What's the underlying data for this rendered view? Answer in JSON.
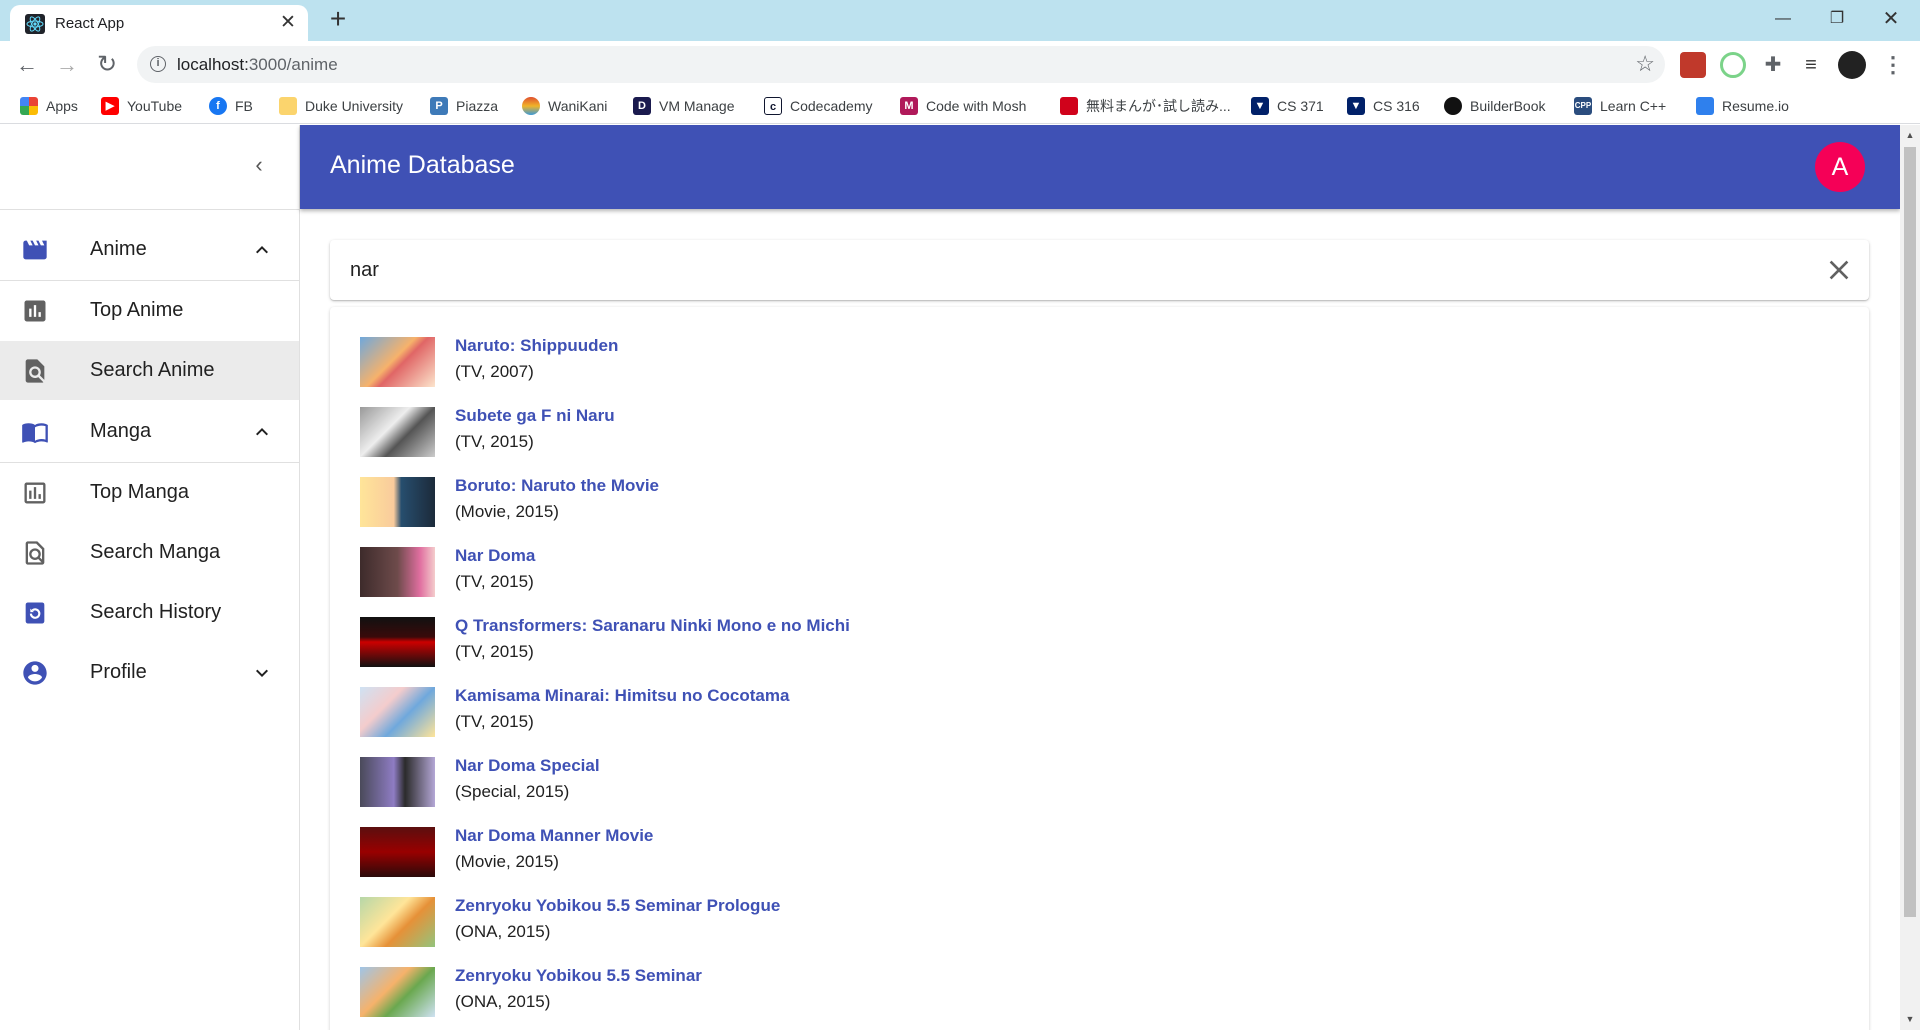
{
  "browser": {
    "tab_title": "React App",
    "url_host": "localhost:",
    "url_path": "3000/anime",
    "bookmarks": [
      {
        "label": "Apps",
        "icon": "apps-grid-icon",
        "color": "#ea4335"
      },
      {
        "label": "YouTube",
        "icon": "youtube-icon",
        "color": "#ff0000"
      },
      {
        "label": "FB",
        "icon": "facebook-icon",
        "color": "#1877f2"
      },
      {
        "label": "Duke University",
        "icon": "folder-icon",
        "color": "#fbd46d"
      },
      {
        "label": "Piazza",
        "icon": "piazza-icon",
        "color": "#3e7ab8"
      },
      {
        "label": "WaniKani",
        "icon": "wanikani-icon",
        "color": "#e04f2f"
      },
      {
        "label": "VM Manage",
        "icon": "vm-icon",
        "color": "#1a1a4e"
      },
      {
        "label": "Codecademy",
        "icon": "codecademy-icon",
        "color": "#10162f"
      },
      {
        "label": "Code with Mosh",
        "icon": "mosh-icon",
        "color": "#b0195a"
      },
      {
        "label": "無料まんが･試し読み...",
        "icon": "manga-site-icon",
        "color": "#d0021b"
      },
      {
        "label": "CS 371",
        "icon": "duke-shield-icon",
        "color": "#012169"
      },
      {
        "label": "CS 316",
        "icon": "duke-shield-icon",
        "color": "#012169"
      },
      {
        "label": "BuilderBook",
        "icon": "builderbook-icon",
        "color": "#111111"
      },
      {
        "label": "Learn C++",
        "icon": "cpp-icon",
        "color": "#2b4d7e"
      },
      {
        "label": "Resume.io",
        "icon": "resume-icon",
        "color": "#2f80ed"
      }
    ]
  },
  "app": {
    "title": "Anime Database",
    "avatar_letter": "A",
    "primary_color": "#3f51b5",
    "avatar_color": "#f50057"
  },
  "sidebar": {
    "items": [
      {
        "label": "Anime",
        "icon": "movie-clapper-icon",
        "chevron": "up"
      },
      {
        "label": "Top Anime",
        "icon": "bar-chart-icon"
      },
      {
        "label": "Search Anime",
        "icon": "find-in-page-icon",
        "selected": true
      },
      {
        "label": "Manga",
        "icon": "book-open-icon",
        "chevron": "up"
      },
      {
        "label": "Top Manga",
        "icon": "bar-chart-outline-icon"
      },
      {
        "label": "Search Manga",
        "icon": "find-in-page-outline-icon"
      },
      {
        "label": "Search History",
        "icon": "history-icon"
      },
      {
        "label": "Profile",
        "icon": "account-circle-icon",
        "chevron": "down"
      }
    ]
  },
  "search": {
    "query": "nar"
  },
  "results": [
    {
      "title": "Naruto: Shippuuden",
      "meta": "(TV, 2007)"
    },
    {
      "title": "Subete ga F ni Naru",
      "meta": "(TV, 2015)"
    },
    {
      "title": "Boruto: Naruto the Movie",
      "meta": "(Movie, 2015)"
    },
    {
      "title": "Nar Doma",
      "meta": "(TV, 2015)"
    },
    {
      "title": "Q Transformers: Saranaru Ninki Mono e no Michi",
      "meta": "(TV, 2015)"
    },
    {
      "title": "Kamisama Minarai: Himitsu no Cocotama",
      "meta": "(TV, 2015)"
    },
    {
      "title": "Nar Doma Special",
      "meta": "(Special, 2015)"
    },
    {
      "title": "Nar Doma Manner Movie",
      "meta": "(Movie, 2015)"
    },
    {
      "title": "Zenryoku Yobikou 5.5 Seminar Prologue",
      "meta": "(ONA, 2015)"
    },
    {
      "title": "Zenryoku Yobikou 5.5 Seminar",
      "meta": "(ONA, 2015)"
    }
  ]
}
